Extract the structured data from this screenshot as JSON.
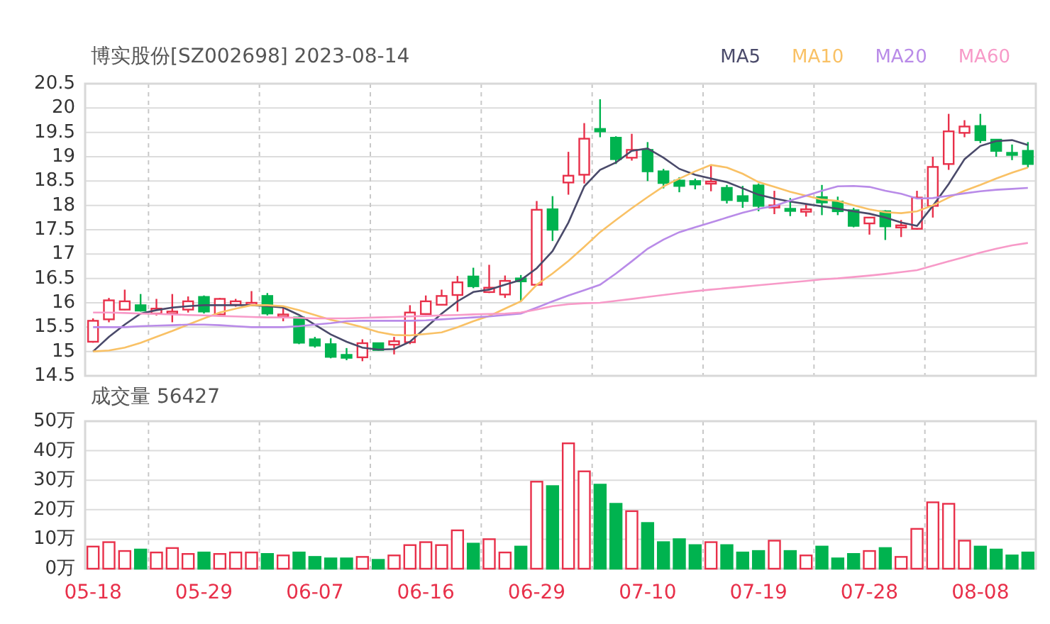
{
  "price_chart": {
    "chart_data": {
      "type": "candlestick",
      "title": "博实股份[SZ002698] 2023-08-14",
      "grid": true,
      "categories": [
        null,
        null,
        null,
        null,
        null,
        null,
        null,
        null,
        null,
        null,
        null,
        null,
        null,
        null,
        null,
        null,
        null,
        null,
        null,
        null,
        null,
        null,
        null,
        null,
        null,
        null,
        null,
        null,
        null,
        null,
        null,
        null,
        null,
        null,
        null,
        null,
        null,
        null,
        null,
        null,
        null,
        null,
        null,
        null,
        null,
        null,
        null,
        null,
        null,
        null,
        null,
        null,
        null,
        null,
        null,
        null,
        null,
        null,
        null,
        null
      ],
      "ylim": [
        14.5,
        20.5
      ],
      "yticks": [
        20.5,
        20,
        19.5,
        19,
        18.5,
        18,
        17.5,
        17,
        16.5,
        16,
        15.5,
        15,
        14.5
      ],
      "series": [
        {
          "name": "MA5",
          "type": "line",
          "color": "#4a4a6a",
          "values": [
            15.0,
            15.3,
            15.55,
            15.78,
            15.85,
            15.9,
            15.93,
            15.95,
            15.95,
            15.95,
            15.95,
            15.93,
            15.9,
            15.75,
            15.55,
            15.35,
            15.2,
            15.08,
            15.04,
            15.05,
            15.2,
            15.49,
            15.78,
            16.03,
            16.22,
            16.27,
            16.37,
            16.47,
            16.71,
            17.06,
            17.65,
            18.39,
            18.73,
            18.88,
            19.12,
            19.17,
            18.98,
            18.75,
            18.63,
            18.55,
            18.48,
            18.35,
            18.22,
            18.14,
            18.08,
            18.03,
            17.98,
            17.93,
            17.88,
            17.83,
            17.75,
            17.65,
            17.58,
            17.99,
            18.44,
            18.95,
            19.22,
            19.32,
            19.34,
            19.24
          ]
        },
        {
          "name": "MA10",
          "type": "line",
          "color": "#f9c165",
          "values": [
            15.0,
            15.02,
            15.08,
            15.18,
            15.3,
            15.42,
            15.55,
            15.68,
            15.8,
            15.88,
            15.95,
            15.95,
            15.93,
            15.85,
            15.75,
            15.65,
            15.58,
            15.5,
            15.4,
            15.34,
            15.33,
            15.36,
            15.39,
            15.5,
            15.62,
            15.73,
            15.88,
            16.03,
            16.37,
            16.6,
            16.86,
            17.15,
            17.45,
            17.7,
            17.94,
            18.17,
            18.39,
            18.55,
            18.7,
            18.83,
            18.78,
            18.65,
            18.48,
            18.38,
            18.28,
            18.2,
            18.12,
            18.09,
            18.0,
            17.92,
            17.86,
            17.84,
            17.88,
            18.0,
            18.16,
            18.3,
            18.42,
            18.55,
            18.67,
            18.78
          ]
        },
        {
          "name": "MA20",
          "type": "line",
          "color": "#b98be8",
          "values": [
            15.5,
            15.5,
            15.5,
            15.52,
            15.53,
            15.54,
            15.55,
            15.55,
            15.54,
            15.52,
            15.5,
            15.5,
            15.5,
            15.52,
            15.55,
            15.58,
            15.62,
            15.63,
            15.63,
            15.63,
            15.63,
            15.64,
            15.66,
            15.68,
            15.7,
            15.72,
            15.75,
            15.78,
            15.9,
            16.03,
            16.15,
            16.26,
            16.37,
            16.6,
            16.85,
            17.11,
            17.3,
            17.45,
            17.55,
            17.65,
            17.75,
            17.85,
            17.93,
            17.99,
            18.1,
            18.2,
            18.3,
            18.39,
            18.4,
            18.38,
            18.3,
            18.24,
            18.14,
            18.15,
            18.2,
            18.25,
            18.29,
            18.32,
            18.34,
            18.36
          ]
        },
        {
          "name": "MA60",
          "type": "line",
          "color": "#f79ac8",
          "values": [
            15.8,
            15.8,
            15.79,
            15.78,
            15.77,
            15.76,
            15.75,
            15.74,
            15.73,
            15.72,
            15.71,
            15.7,
            15.7,
            15.69,
            15.68,
            15.68,
            15.68,
            15.69,
            15.7,
            15.71,
            15.72,
            15.73,
            15.74,
            15.75,
            15.76,
            15.77,
            15.78,
            15.8,
            15.86,
            15.93,
            15.97,
            15.99,
            16.0,
            16.04,
            16.08,
            16.12,
            16.16,
            16.2,
            16.24,
            16.27,
            16.3,
            16.33,
            16.36,
            16.39,
            16.42,
            16.45,
            16.48,
            16.5,
            16.53,
            16.56,
            16.59,
            16.63,
            16.67,
            16.76,
            16.85,
            16.94,
            17.03,
            17.11,
            17.18,
            17.23
          ]
        }
      ],
      "ohlc": [
        [
          15.2,
          15.68,
          15.18,
          15.63
        ],
        [
          15.66,
          16.1,
          15.6,
          16.05
        ],
        [
          15.86,
          16.27,
          15.85,
          16.03
        ],
        [
          15.95,
          16.18,
          15.82,
          15.84
        ],
        [
          15.78,
          16.08,
          15.74,
          15.88
        ],
        [
          15.8,
          16.18,
          15.6,
          15.82
        ],
        [
          15.86,
          16.13,
          15.8,
          16.03
        ],
        [
          16.12,
          16.15,
          15.78,
          15.82
        ],
        [
          15.76,
          16.1,
          15.74,
          16.08
        ],
        [
          15.96,
          16.08,
          15.92,
          16.03
        ],
        [
          15.98,
          16.24,
          15.93,
          16.0
        ],
        [
          16.14,
          16.2,
          15.74,
          15.78
        ],
        [
          15.72,
          15.92,
          15.62,
          15.76
        ],
        [
          15.7,
          15.72,
          15.15,
          15.18
        ],
        [
          15.25,
          15.3,
          15.08,
          15.12
        ],
        [
          15.15,
          15.27,
          14.86,
          14.89
        ],
        [
          14.93,
          15.07,
          14.82,
          14.87
        ],
        [
          14.88,
          15.25,
          14.8,
          15.17
        ],
        [
          15.17,
          15.17,
          15.02,
          15.03
        ],
        [
          15.14,
          15.3,
          14.94,
          15.21
        ],
        [
          15.19,
          15.95,
          15.15,
          15.8
        ],
        [
          15.77,
          16.15,
          15.75,
          16.03
        ],
        [
          15.96,
          16.27,
          15.95,
          16.14
        ],
        [
          16.16,
          16.55,
          15.82,
          16.42
        ],
        [
          16.54,
          16.72,
          16.3,
          16.34
        ],
        [
          16.22,
          16.78,
          16.2,
          16.31
        ],
        [
          16.17,
          16.56,
          16.1,
          16.45
        ],
        [
          16.5,
          16.57,
          16.03,
          16.44
        ],
        [
          16.37,
          18.09,
          16.35,
          17.91
        ],
        [
          17.92,
          18.19,
          17.27,
          17.5
        ],
        [
          18.47,
          19.1,
          18.22,
          18.61
        ],
        [
          18.63,
          19.69,
          18.45,
          19.37
        ],
        [
          19.57,
          20.18,
          19.4,
          19.52
        ],
        [
          19.39,
          19.42,
          18.85,
          18.95
        ],
        [
          18.98,
          19.47,
          18.92,
          19.14
        ],
        [
          19.14,
          19.3,
          18.5,
          18.7
        ],
        [
          18.7,
          18.75,
          18.35,
          18.46
        ],
        [
          18.51,
          18.58,
          18.27,
          18.4
        ],
        [
          18.5,
          18.55,
          18.33,
          18.43
        ],
        [
          18.45,
          18.83,
          18.29,
          18.49
        ],
        [
          18.36,
          18.42,
          18.04,
          18.11
        ],
        [
          18.19,
          18.4,
          17.95,
          18.09
        ],
        [
          18.41,
          18.45,
          17.88,
          17.99
        ],
        [
          17.96,
          18.3,
          17.82,
          18.0
        ],
        [
          17.93,
          18.15,
          17.78,
          17.9
        ],
        [
          17.87,
          18.02,
          17.77,
          17.92
        ],
        [
          18.17,
          18.42,
          17.8,
          18.06
        ],
        [
          18.08,
          18.18,
          17.8,
          17.88
        ],
        [
          17.9,
          17.95,
          17.55,
          17.58
        ],
        [
          17.63,
          17.75,
          17.4,
          17.75
        ],
        [
          17.88,
          17.9,
          17.29,
          17.57
        ],
        [
          17.55,
          17.7,
          17.35,
          17.59
        ],
        [
          17.52,
          18.3,
          17.5,
          18.16
        ],
        [
          17.99,
          19.0,
          17.75,
          18.79
        ],
        [
          18.85,
          19.88,
          18.73,
          19.52
        ],
        [
          19.49,
          19.75,
          19.4,
          19.62
        ],
        [
          19.63,
          19.88,
          19.28,
          19.34
        ],
        [
          19.35,
          19.35,
          19.0,
          19.12
        ],
        [
          19.08,
          19.25,
          18.93,
          19.06
        ],
        [
          19.12,
          19.3,
          18.78,
          18.85
        ]
      ]
    }
  },
  "volume_chart": {
    "chart_data": {
      "type": "bar",
      "title": "成交量 56427",
      "grid": true,
      "categories": [
        "05-18",
        null,
        null,
        null,
        null,
        null,
        null,
        "05-29",
        null,
        null,
        null,
        null,
        null,
        null,
        "06-07",
        null,
        null,
        null,
        null,
        null,
        null,
        "06-16",
        null,
        null,
        null,
        null,
        null,
        null,
        "06-29",
        null,
        null,
        null,
        null,
        null,
        null,
        "07-10",
        null,
        null,
        null,
        null,
        null,
        null,
        "07-19",
        null,
        null,
        null,
        null,
        null,
        null,
        "07-28",
        null,
        null,
        null,
        null,
        null,
        null,
        "08-08",
        null,
        null,
        null
      ],
      "ylim": [
        0,
        50
      ],
      "yticks": [
        {
          "value": 50,
          "label": "50万"
        },
        {
          "value": 40,
          "label": "40万"
        },
        {
          "value": 30,
          "label": "30万"
        },
        {
          "value": 20,
          "label": "20万"
        },
        {
          "value": 10,
          "label": "10万"
        },
        {
          "value": 0,
          "label": "0万"
        }
      ],
      "values": [
        7.5,
        9,
        6,
        6.5,
        5.5,
        7,
        5,
        5.5,
        5,
        5.5,
        5.5,
        5,
        4.5,
        5.5,
        4,
        3.5,
        3.5,
        4,
        3,
        4.5,
        8,
        9,
        8,
        13,
        8.5,
        10,
        5.5,
        7.5,
        29.5,
        28,
        42.5,
        33,
        28.5,
        22,
        19.5,
        15.5,
        9,
        10,
        8,
        9,
        8,
        5.5,
        6,
        9.5,
        6,
        4.5,
        7.5,
        3.5,
        5,
        6,
        7,
        4,
        13.5,
        22.5,
        22,
        9.5,
        7.5,
        6.5,
        4.5,
        5.5
      ]
    }
  }
}
